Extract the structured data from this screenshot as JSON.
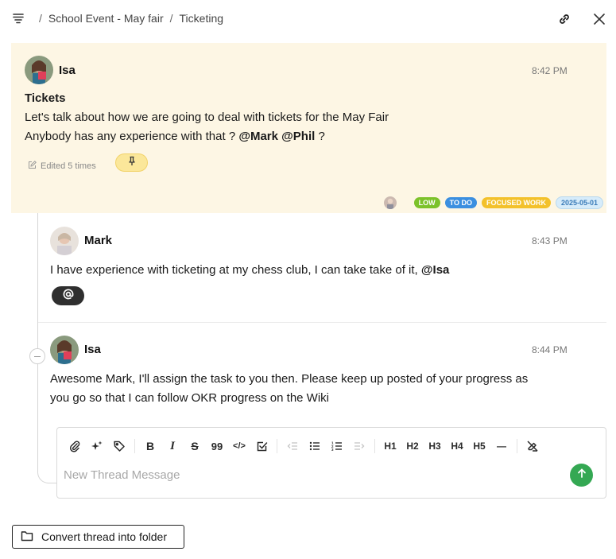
{
  "breadcrumb": {
    "separator": "/",
    "items": [
      "School Event - May fair",
      "Ticketing"
    ]
  },
  "main_message": {
    "author": "Isa",
    "time": "8:42 PM",
    "title": "Tickets",
    "line1": "Let's talk about how we are going to deal with tickets for the May Fair",
    "line2_prefix": "Anybody has any experience with that ?",
    "mention1": "@Mark",
    "mention2": "@Phil",
    "line2_suffix": "?",
    "edited": "Edited 5 times",
    "tags": [
      {
        "label": "LOW",
        "color": "#7cc22a"
      },
      {
        "label": "TO DO",
        "color": "#3b8fe0"
      },
      {
        "label": "FOCUSED WORK",
        "color": "#f3c12b"
      },
      {
        "label": "2025-05-01",
        "color": "#d7ecfa",
        "text_color": "#3a7bb8"
      }
    ],
    "background": "#fdf6e4"
  },
  "replies": [
    {
      "author": "Mark",
      "time": "8:43 PM",
      "text_prefix": "I have experience with ticketing at my chess club, I can take take of it,",
      "mention": "@Isa"
    },
    {
      "author": "Isa",
      "time": "8:44 PM",
      "line1": "Awesome Mark, I'll assign the task to you then. Please keep up posted of your progress as",
      "line2": "you go so that I can follow  OKR progress on the Wiki"
    }
  ],
  "editor": {
    "placeholder": "New Thread Message",
    "toolbar": {
      "bold": "B",
      "italic": "I",
      "strike": "S",
      "quote": "99",
      "code": "</>",
      "h1": "H1",
      "h2": "H2",
      "h3": "H3",
      "h4": "H4",
      "h5": "H5",
      "hr": "—"
    },
    "send_color": "#34a853"
  },
  "convert_button": {
    "label": "Convert thread into folder"
  }
}
